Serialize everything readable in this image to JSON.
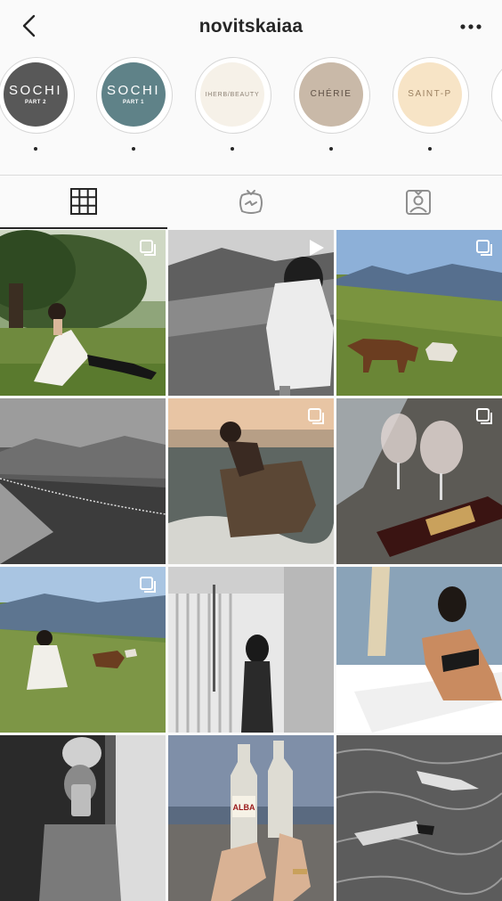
{
  "header": {
    "username": "novitskaiaa",
    "back_icon": "chevron-left-icon",
    "more_icon": "more-horizontal-icon"
  },
  "highlights": [
    {
      "title": "SOCHI",
      "subtitle": "PART 2",
      "bg": "#585858",
      "fg": "#ffffff"
    },
    {
      "title": "SOCHI",
      "subtitle": "PART 1",
      "bg": "#5f8288",
      "fg": "#ffffff"
    },
    {
      "title": "IHERB/BEAUTY",
      "subtitle": "",
      "bg": "#f6f1e8",
      "fg": "#8a7f72"
    },
    {
      "title": "CHÉRIE",
      "subtitle": "",
      "bg": "#c9b9a8",
      "fg": "#5d4f44"
    },
    {
      "title": "SAINT-P",
      "subtitle": "",
      "bg": "#f7e4c6",
      "fg": "#9b8060"
    }
  ],
  "tabs": [
    {
      "name": "grid",
      "icon": "grid-icon",
      "active": true
    },
    {
      "name": "igtv",
      "icon": "igtv-icon",
      "active": false
    },
    {
      "name": "tagged",
      "icon": "tagged-icon",
      "active": false
    }
  ],
  "posts": [
    {
      "id": "post-1",
      "scene": "Woman in white dress sitting on grass under tree",
      "badge": "carousel"
    },
    {
      "id": "post-2",
      "scene": "Woman in white overlooking misty mountains, black and white",
      "badge": "video"
    },
    {
      "id": "post-3",
      "scene": "Horses grazing on mountain slope",
      "badge": "carousel"
    },
    {
      "id": "post-4",
      "scene": "Mountain valley with cable line, black and white",
      "badge": "none"
    },
    {
      "id": "post-5",
      "scene": "Woman sitting on rock in the sea",
      "badge": "carousel"
    },
    {
      "id": "post-6",
      "scene": "Wine glasses and bottle on pebbles",
      "badge": "carousel"
    },
    {
      "id": "post-7",
      "scene": "Woman walking on mountain meadow with horses",
      "badge": "carousel"
    },
    {
      "id": "post-8",
      "scene": "Woman under outdoor shower, black and white",
      "badge": "none"
    },
    {
      "id": "post-9",
      "scene": "Woman in sunglasses on sun lounger",
      "badge": "none"
    },
    {
      "id": "post-10",
      "scene": "Mirror selfie with towel on head, black and white",
      "badge": "none"
    },
    {
      "id": "post-11",
      "scene": "Hands holding two bottles by the sea",
      "badge": "none"
    },
    {
      "id": "post-12",
      "scene": "Underwater swimming, black and white",
      "badge": "none"
    }
  ],
  "bottle_label": "ALBA"
}
